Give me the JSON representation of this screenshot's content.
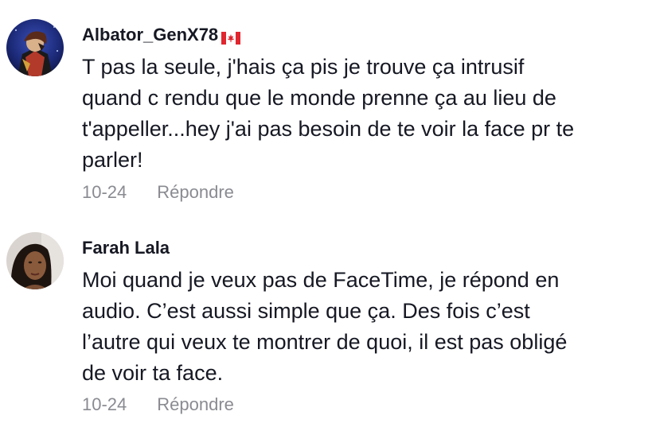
{
  "comments": [
    {
      "username": "Albator_GenX78",
      "flag": "canada-flag-icon",
      "text": "T pas la seule, j'hais ça pis je trouve ça intrusif\nquand c rendu que le monde prenne ça au lieu de\nt'appeller...hey j'ai pas besoin de te voir la face pr te\nparler!",
      "date": "10-24",
      "reply_label": "Répondre"
    },
    {
      "username": "Farah Lala",
      "text": "Moi quand je veux pas de FaceTime, je répond en\naudio. C’est aussi simple que ça. Des fois c’est\nl’autre qui veux te montrer de quoi, il est pas obligé\nde voir ta face.",
      "date": "10-24",
      "reply_label": "Répondre"
    }
  ],
  "colors": {
    "username": "#161823",
    "text": "#161823",
    "meta": "#8a8b91",
    "flag_red": "#e0262f"
  }
}
